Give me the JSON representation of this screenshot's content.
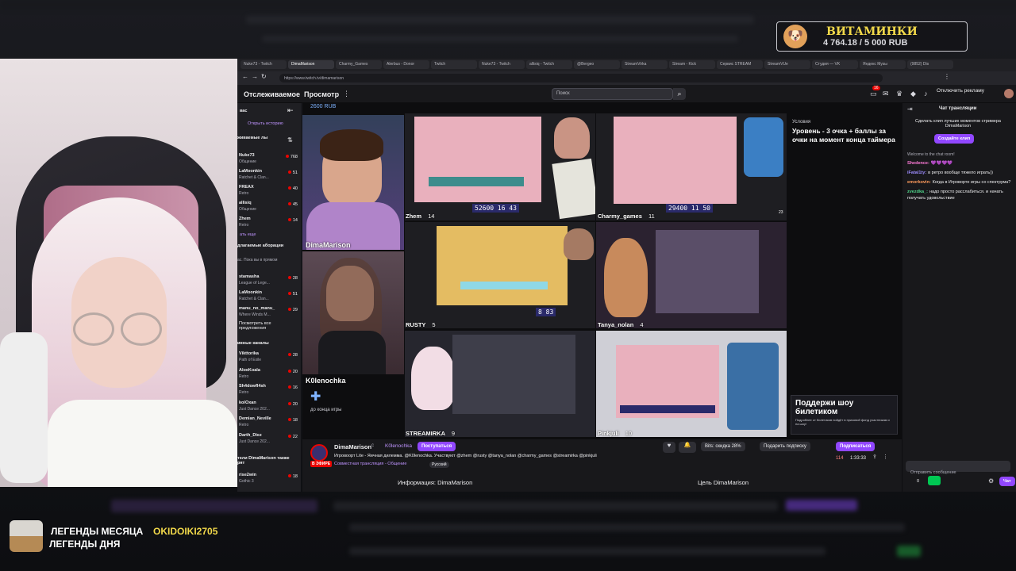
{
  "overlay": {
    "donation_goal_title": "ВИТАМИНКИ",
    "donation_goal_progress": "4 764.18 / 5 000 RUB",
    "donation_goal_fraction": 0.9528,
    "legends_month_label": "ЛЕГЕНДЫ МЕСЯЦА",
    "legends_month_name": "OKIDOIKI2705",
    "legends_day_label": "ЛЕГЕНДЫ ДНЯ"
  },
  "browser": {
    "tabs": [
      "Nuke73 - Twitch",
      "DimaMarison",
      "Charmy_Games",
      "Alerbus - Donor",
      "Twitch",
      "Nuke73 - Twitch",
      "allisiq - Twitch",
      "@Bergeo",
      "StreamVirka",
      "Stream - Kick",
      "Сервис STREAM",
      "StreamVUe",
      "Студия — VK",
      "Яндекс Музы",
      "(9852) Dis"
    ],
    "active_tab": 1,
    "url": "https://www.twitch.tv/dimamarison"
  },
  "topnav": {
    "following": "Отслеживаемое",
    "browse": "Просмотр",
    "search_placeholder": "Поиск",
    "notif_count": "16",
    "disable_ads": "Отключить рекламу"
  },
  "sidebar": {
    "collapsed_header": "вас",
    "history_link": "Открыть историю",
    "followed_header": "живаемые лы",
    "followed": [
      {
        "name": "Nuke73",
        "sub": "Общение",
        "count": "768"
      },
      {
        "name": "LaMoonkin",
        "sub": "Ratchet & Clan...",
        "count": "51"
      },
      {
        "name": "FREAX",
        "sub": "Retro",
        "count": "40"
      },
      {
        "name": "allisiq",
        "sub": "Общение",
        "count": "45"
      },
      {
        "name": "Zhem",
        "sub": "Retro",
        "count": "14"
      }
    ],
    "show_more": "ать еще",
    "suggested_header": "длагаемые аборации",
    "suggested_sub": "ас. Пока вы в прямом",
    "suggested": [
      {
        "name": "stamasha",
        "sub": "League of Lege...",
        "count": "28"
      },
      {
        "name": "LaMoonkin",
        "sub": "Ratchet & Clan...",
        "count": "51"
      },
      {
        "name": "manu_no_manu_",
        "sub": "Where Winds M...",
        "count": "29"
      }
    ],
    "see_all": "Посмотреть все предложения",
    "live_header": "ивные каналы",
    "live": [
      {
        "name": "Vikttorika",
        "sub": "Path of Exile",
        "count": "28"
      },
      {
        "name": "AloeKoala",
        "sub": "Retro",
        "count": "20"
      },
      {
        "name": "Sh4dowfl4sh",
        "sub": "Retro",
        "count": "16"
      },
      {
        "name": "kolOxan",
        "sub": "Just Dance 202...",
        "count": "20"
      },
      {
        "name": "Demian_Neville",
        "sub": "Retro",
        "count": "18"
      },
      {
        "name": "Darth_Diez",
        "sub": "Just Dance 202...",
        "count": "22"
      }
    ],
    "viewers_header": "тели DimaMarison также рят",
    "viewers_also": [
      {
        "name": "rise2win",
        "sub": "Gothic 3",
        "count": "18"
      }
    ]
  },
  "grid": {
    "rub_badge": "2600 RUB",
    "tiles": {
      "dimamarison": "DimaMarison",
      "k0lenochka": "K0lenochka",
      "zhem": "Zhem",
      "zhem_count": "14",
      "charmy": "Charmy_games",
      "charmy_count": "11",
      "rusty": "RUSTY",
      "rusty_count": "5",
      "tanya": "Tanya_nolan",
      "tanya_count": "4",
      "streamirka": "STREAMIRKA",
      "streamirka_count": "9",
      "pinkjuli": "Pinkjuli",
      "pinkjuli_count": "10"
    },
    "huds": {
      "zhem": "52600 16 43",
      "charmy": "29400 11 50",
      "rusty": "8 83"
    },
    "timer_label": "до конца игры",
    "rules_title": "Условия",
    "rules_text": "Уровень - 3 очка + баллы за очки на момент конца таймера",
    "support_title": "Поддержи шоу билетиком",
    "support_text": "Подробнее от билетиков пойдёт в призовой фонд участникам и на шоу!",
    "small_count": "23"
  },
  "infobar": {
    "streamer": "DimaMarison",
    "with": "с",
    "cohost": "K0lenochka",
    "follow_btn": "Поступаться",
    "live_badge": "В ЭФИРЕ",
    "title": "Игровоорт Lite - Яичная дилемма. @K0lenochka. Участвуют @zhem @rusty @tanya_nolan @charmy_games @streamirka @pinkjuli",
    "category": "Совместная трансляция - Общение",
    "language": "Русский",
    "bits": "Bits: скидка 28%",
    "gift": "Подарить подписку",
    "subscribe": "Подписаться",
    "viewers": "114",
    "uptime": "1:33:33",
    "about": "Информация: DimaMarison",
    "goal": "Цель DimaMarison"
  },
  "chat": {
    "title": "Чат трансляции",
    "clip_promo": "Сделать клип лучших моментов стримера DimaMarison",
    "clip_btn": "Создайте клип",
    "welcome": "Welcome to the chat room!",
    "messages": [
      {
        "user": "Shedence:",
        "text": "💜💜💜💜"
      },
      {
        "user": "iFatal1ty:",
        "text": "в ретро вообще тяжело играть))"
      },
      {
        "user": "emorkovin:",
        "text": "Когда в Игроворте игры со спектрума?"
      },
      {
        "user": "zvezdka_:",
        "text": "надо просто расслабиться. и начать получать удовольствие"
      }
    ],
    "input_placeholder": "Отправить сообщение",
    "points": "0",
    "send": "Чат"
  },
  "colors": {
    "twitch_purple": "#9147ff",
    "live_red": "#eb0400",
    "game_pink": "#e9b0bd"
  }
}
